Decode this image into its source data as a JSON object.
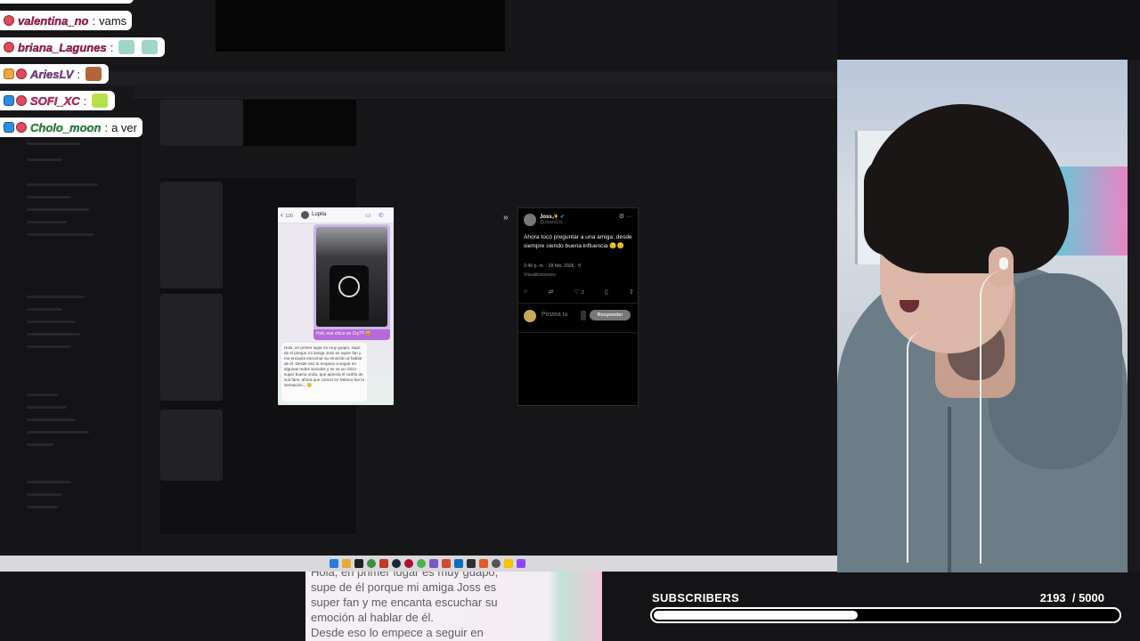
{
  "chat": {
    "messages": [
      {
        "user": "valentina_no",
        "user_color": "#c2185b",
        "badges": [
          "mod"
        ],
        "text": "vams"
      },
      {
        "user": "briana_Lagunes",
        "user_color": "#c2185b",
        "badges": [
          "mod"
        ],
        "text": "",
        "emotes": [
          "emote-face",
          "emote-face"
        ]
      },
      {
        "user": "AriesLV",
        "user_color": "#8e44ad",
        "badges": [
          "sub",
          "mod"
        ],
        "text": "",
        "emotes": [
          "emote-picture"
        ]
      },
      {
        "user": "SOFI_XC",
        "user_color": "#e0245e",
        "badges": [
          "cube",
          "mod"
        ],
        "text": "",
        "emotes": [
          "emote-sign"
        ]
      },
      {
        "user": "Cholo_moon",
        "user_color": "#2ea043",
        "badges": [
          "cube",
          "mod"
        ],
        "text": "a ver"
      }
    ],
    "separator": ":"
  },
  "media": {
    "chat_screenshot": {
      "back_count": "120",
      "contact_name": "Lupita",
      "photo_caption": "Holi, ese chico es Cry?? 😆",
      "message": "Hola, en primer lugar es muy guapo, supe de él porque mi amiga Joss es super fan y me encanta escuchar su emoción al hablar de él. Desde eso lo empece a seguir en algunas redes sociales y se ve un chico super buena onda, que aprecia el cariño de sus fans, ahora que conocí en México fue la sensación... 😊"
    },
    "tweet": {
      "display_name": "Joss✨",
      "handle": "@JossxCry",
      "text": "Ahora tocó preguntar a una amiga; desde siempre siendo buena influencia 😌😊",
      "timestamp": "2:40 p. m. · 28 feb. 2026 · 8",
      "views_label": "Visualizaciones",
      "like_count": "2",
      "reply_placeholder": "Postea tu",
      "reply_button": "Responder"
    }
  },
  "zoom_text": [
    "Hola, en primer lugar es muy guapo,",
    "supe de él porque mi amiga Joss es",
    "super fan y me encanta escuchar su",
    "emoción al hablar de él.",
    "Desde eso lo empece a seguir en"
  ],
  "subscribers": {
    "label": "SUBSCRIBERS",
    "current": "2193",
    "goal_text": "/ 5000",
    "progress": 0.4386
  },
  "taskbar": {
    "icon_colors": [
      "#2b7bd8",
      "#e8a93a",
      "#222222",
      "#3a8f3a",
      "#c0392b",
      "#1b2838",
      "#b01030",
      "#4caf50",
      "#7e57c2",
      "#d04a30",
      "#0f6cbd",
      "#303030",
      "#e05a2b",
      "#555555",
      "#f5c400",
      "#9146ff"
    ]
  },
  "colors": {
    "accent_purple": "#b46ad8",
    "subs_bar": "#ffffff"
  }
}
